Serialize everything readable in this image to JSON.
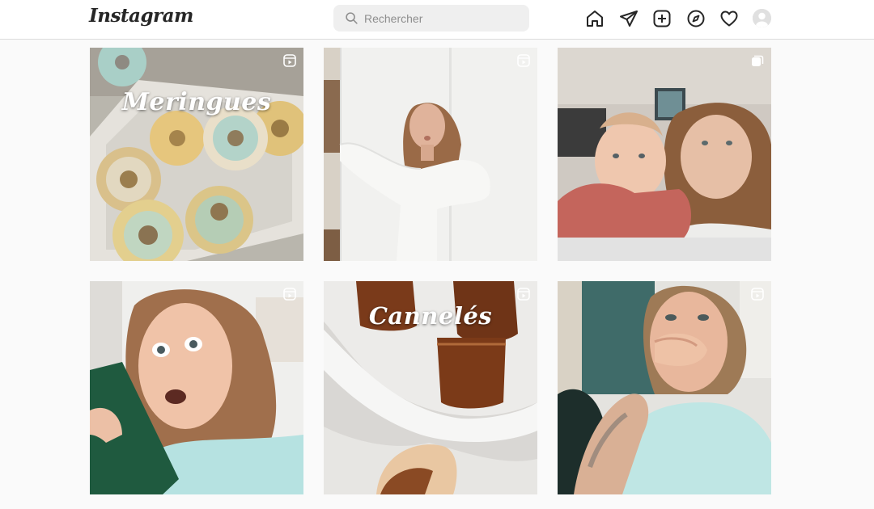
{
  "header": {
    "logo_text": "Instagram",
    "search": {
      "placeholder": "Rechercher",
      "value": ""
    },
    "nav_icons": [
      "home-icon",
      "direct-icon",
      "new-post-icon",
      "explore-icon",
      "activity-icon",
      "profile-avatar"
    ]
  },
  "posts": [
    {
      "type": "reel",
      "overlay_text": "Meringues",
      "badge_icon": "reels-icon"
    },
    {
      "type": "reel",
      "overlay_text": "",
      "badge_icon": "reels-icon"
    },
    {
      "type": "carousel",
      "overlay_text": "",
      "badge_icon": "carousel-icon"
    },
    {
      "type": "reel",
      "overlay_text": "",
      "badge_icon": "reels-icon"
    },
    {
      "type": "reel",
      "overlay_text": "Cannelés",
      "badge_icon": "reels-icon"
    },
    {
      "type": "reel",
      "overlay_text": "",
      "badge_icon": "reels-icon"
    }
  ],
  "colors": {
    "header_bg": "#ffffff",
    "page_bg": "#fafafa",
    "border": "#dbdbdb",
    "search_bg": "#efefef"
  }
}
